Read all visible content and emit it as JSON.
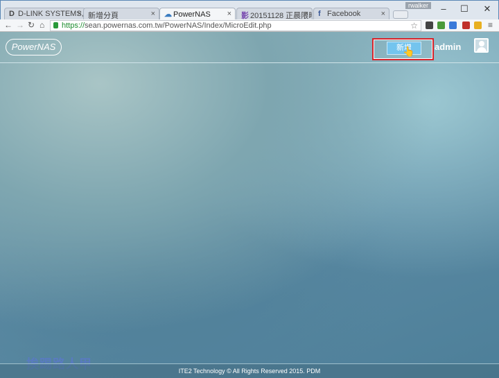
{
  "browser": {
    "tabs": [
      {
        "icon": "D",
        "label": "D-LINK SYSTEMS, I"
      },
      {
        "icon": "",
        "label": "新增分頁"
      },
      {
        "icon": "☁",
        "label": "PowerNAS"
      },
      {
        "icon": "影",
        "label": "20151128 正晨限時"
      },
      {
        "icon": "f",
        "label": "Facebook"
      }
    ],
    "profile_name": "rwalker",
    "url_scheme": "https://",
    "url_rest": "sean.powernas.com.tw/PowerNAS/Index/MicroEdit.php",
    "window_controls": [
      "–",
      "☐",
      "✕"
    ]
  },
  "header": {
    "logo_text": "PowerNAS",
    "add_button": "新增",
    "user": "admin",
    "highlight_color": "#d8232a"
  },
  "footer": {
    "text": "ITE2 Technology © All Rights Reserved 2015. PDM"
  },
  "watermark": "挨踢路人甲"
}
